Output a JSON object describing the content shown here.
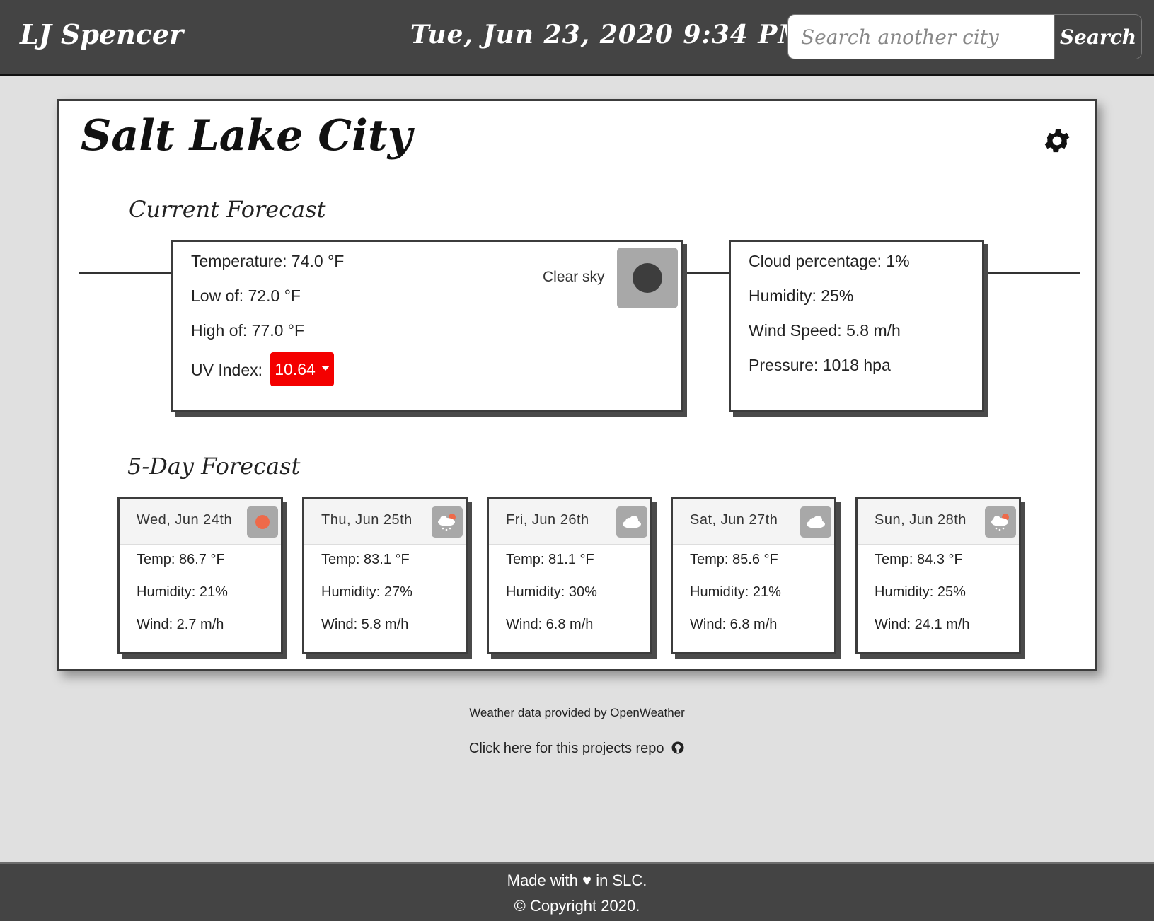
{
  "header": {
    "brand": "LJ Spencer",
    "datetime": "Tue, Jun 23, 2020 9:34 PM",
    "search_placeholder": "Search another city",
    "search_button": "Search"
  },
  "city": "Salt Lake City",
  "current": {
    "section_title": "Current Forecast",
    "temperature": "Temperature: 74.0 °F",
    "low": "Low of: 72.0 °F",
    "high": "High of: 77.0 °F",
    "uv_label": "UV Index:",
    "uv_value": "10.64",
    "uv_color": "#f40000",
    "sky": "Clear sky",
    "sky_icon": "moon-icon",
    "cloud": "Cloud percentage: 1%",
    "humidity": "Humidity: 25%",
    "wind": "Wind Speed: 5.8 m/h",
    "pressure": "Pressure: 1018 hpa"
  },
  "forecast": {
    "section_title": "5-Day Forecast",
    "days": [
      {
        "date": "Wed, Jun 24th",
        "icon": "sun-icon",
        "temp": "Temp: 86.7 °F",
        "humidity": "Humidity: 21%",
        "wind": "Wind: 2.7 m/h"
      },
      {
        "date": "Thu, Jun 25th",
        "icon": "rain-cloud-icon",
        "temp": "Temp: 83.1 °F",
        "humidity": "Humidity: 27%",
        "wind": "Wind: 5.8 m/h"
      },
      {
        "date": "Fri, Jun 26th",
        "icon": "cloud-icon",
        "temp": "Temp: 81.1 °F",
        "humidity": "Humidity: 30%",
        "wind": "Wind: 6.8 m/h"
      },
      {
        "date": "Sat, Jun 27th",
        "icon": "cloud-icon",
        "temp": "Temp: 85.6 °F",
        "humidity": "Humidity: 21%",
        "wind": "Wind: 6.8 m/h"
      },
      {
        "date": "Sun, Jun 28th",
        "icon": "rain-cloud-icon",
        "temp": "Temp: 84.3 °F",
        "humidity": "Humidity: 25%",
        "wind": "Wind: 24.1 m/h"
      }
    ]
  },
  "footer": {
    "credit": "Weather data provided by OpenWeather",
    "repo": "Click here for this projects repo",
    "made_with": "Made with ♥ in SLC.",
    "copyright": "© Copyright 2020."
  }
}
